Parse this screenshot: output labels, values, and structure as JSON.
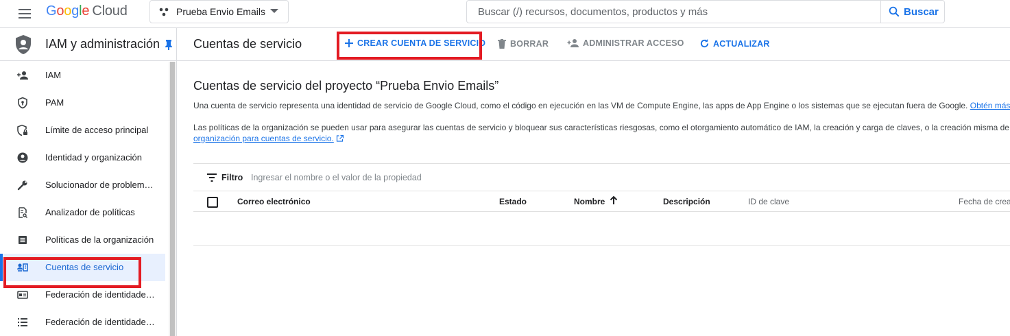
{
  "topbar": {
    "logo": {
      "g1": "G",
      "g2": "o",
      "g3": "o",
      "g4": "g",
      "g5": "l",
      "g6": "e",
      "cloud": "Cloud"
    },
    "project": "Prueba Envio Emails",
    "search_placeholder": "Buscar (/) recursos, documentos, productos y más",
    "search_button": "Buscar"
  },
  "sidebar": {
    "title": "IAM y administración",
    "items": [
      {
        "label": "IAM",
        "icon": "person-add-icon"
      },
      {
        "label": "PAM",
        "icon": "shield-icon"
      },
      {
        "label": "Límite de acceso principal",
        "icon": "shield-lock-icon"
      },
      {
        "label": "Identidad y organización",
        "icon": "account-circle-icon"
      },
      {
        "label": "Solucionador de problem…",
        "icon": "wrench-icon"
      },
      {
        "label": "Analizador de políticas",
        "icon": "doc-search-icon"
      },
      {
        "label": "Políticas de la organización",
        "icon": "list-doc-icon"
      },
      {
        "label": "Cuentas de servicio",
        "icon": "service-account-icon",
        "active": true
      },
      {
        "label": "Federación de identidade…",
        "icon": "id-card-icon"
      },
      {
        "label": "Federación de identidade…",
        "icon": "list-icon"
      }
    ]
  },
  "actionbar": {
    "title": "Cuentas de servicio",
    "create": "CREAR CUENTA DE SERVICIO",
    "delete": "BORRAR",
    "manage": "ADMINISTRAR ACCESO",
    "refresh": "ACTUALIZAR"
  },
  "main": {
    "heading": "Cuentas de servicio del proyecto “Prueba Envio Emails”",
    "desc1": "Una cuenta de servicio representa una identidad de servicio de Google Cloud, como el código en ejecución en las VM de Compute Engine, las apps de App Engine o los sistemas que se ejecutan fuera de Google.",
    "desc1_link": "Obtén más inf",
    "desc2": "Las políticas de la organización se pueden usar para asegurar las cuentas de servicio y bloquear sus características riesgosas, como el otorgamiento automático de IAM, la creación y carga de claves, o la creación misma de c",
    "desc2_link": "organización para cuentas de servicio.",
    "filter_label": "Filtro",
    "filter_placeholder": "Ingresar el nombre o el valor de la propiedad",
    "columns": {
      "email": "Correo electrónico",
      "status": "Estado",
      "name": "Nombre",
      "description": "Descripción",
      "key_id": "ID de clave",
      "created": "Fecha de crea"
    }
  },
  "colors": {
    "accent": "#1a73e8",
    "highlight": "#e31b23",
    "active_bg": "#e8f0fe"
  }
}
